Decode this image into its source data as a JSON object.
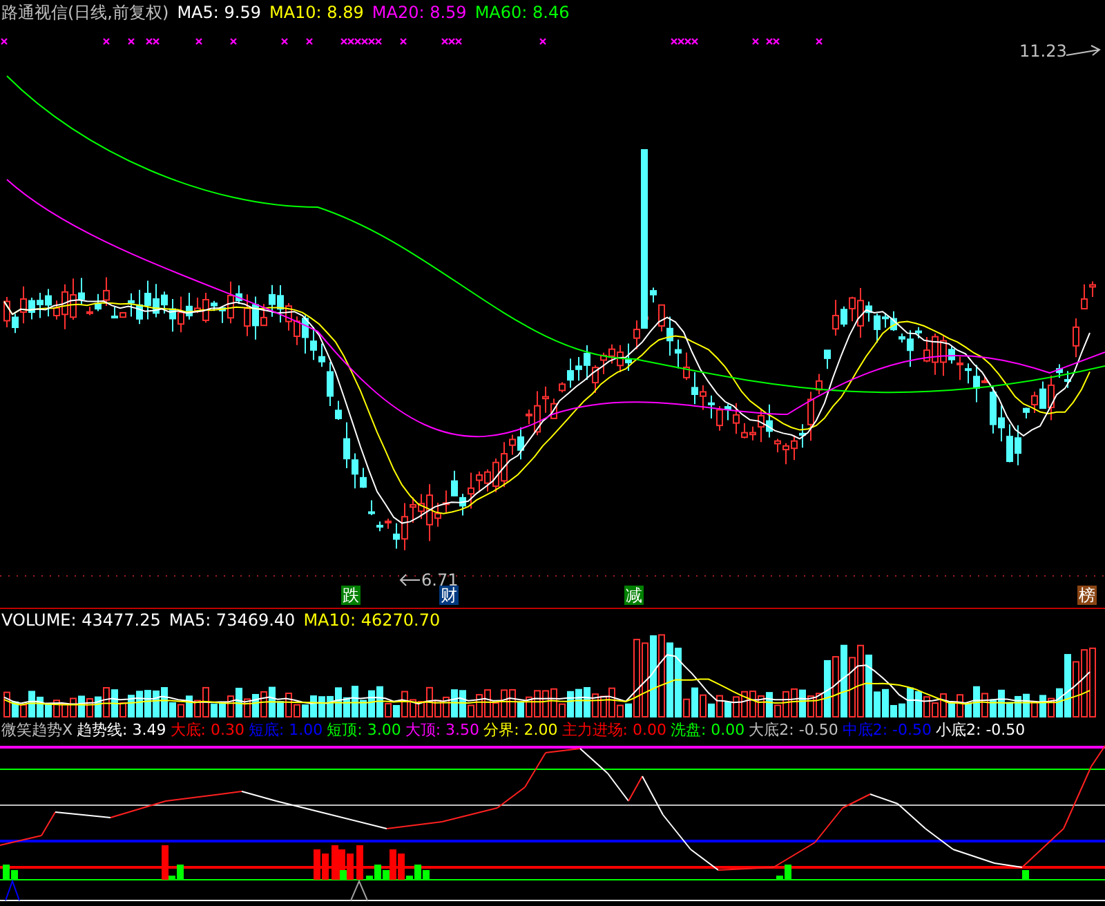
{
  "price_panel": {
    "title": "路通视信(日线,前复权)",
    "indicators": [
      {
        "label": "MA5: 9.59",
        "color": "#ffffff"
      },
      {
        "label": "MA10: 8.89",
        "color": "#ffff00"
      },
      {
        "label": "MA20: 8.59",
        "color": "#ff00ff"
      },
      {
        "label": "MA60: 8.46",
        "color": "#00ff00"
      }
    ],
    "high_label": "11.23",
    "low_label": "6.71",
    "signals": [
      {
        "text": "跌",
        "color": "#008000"
      },
      {
        "text": "财",
        "color": "#003a80"
      },
      {
        "text": "减",
        "color": "#008000"
      },
      {
        "text": "榜",
        "color": "#8b4513"
      }
    ]
  },
  "volume_panel": {
    "indicators": [
      {
        "label": "VOLUME: 43477.25",
        "color": "#ffffff"
      },
      {
        "label": "MA5: 73469.40",
        "color": "#ffffff"
      },
      {
        "label": "MA10: 46270.70",
        "color": "#ffff00"
      }
    ]
  },
  "indicator_panel": {
    "title": "微笑趋势X",
    "indicators": [
      {
        "label": "趋势线: 3.49",
        "color": "#ffffff"
      },
      {
        "label": "大底: 0.30",
        "color": "#ff0000"
      },
      {
        "label": "短底: 1.00",
        "color": "#0000ff"
      },
      {
        "label": "短顶: 3.00",
        "color": "#00ff00"
      },
      {
        "label": "大顶: 3.50",
        "color": "#ff00ff"
      },
      {
        "label": "分界: 2.00",
        "color": "#ffff00"
      },
      {
        "label": "主力进场: 0.00",
        "color": "#ff0000"
      },
      {
        "label": "洗盘: 0.00",
        "color": "#00ff00"
      },
      {
        "label": "大底2: -0.50",
        "color": "#c0c0c0"
      },
      {
        "label": "中底2: -0.50",
        "color": "#0000ff"
      },
      {
        "label": "小底2: -0.50",
        "color": "#ffffff"
      }
    ]
  }
}
